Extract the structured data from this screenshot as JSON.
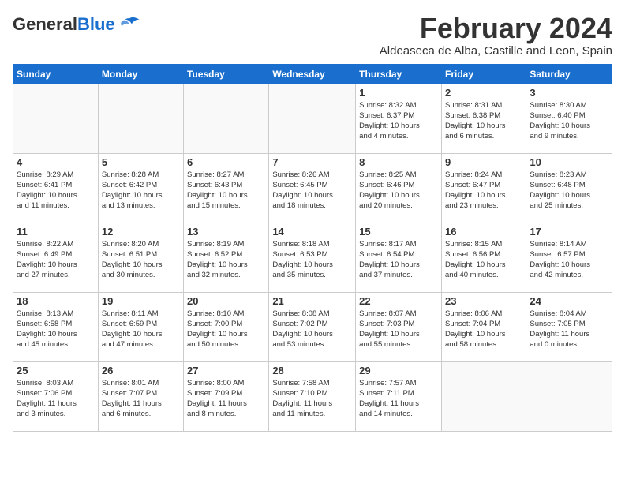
{
  "header": {
    "logo_general": "General",
    "logo_blue": "Blue",
    "month_title": "February 2024",
    "location": "Aldeaseca de Alba, Castille and Leon, Spain"
  },
  "weekdays": [
    "Sunday",
    "Monday",
    "Tuesday",
    "Wednesday",
    "Thursday",
    "Friday",
    "Saturday"
  ],
  "weeks": [
    [
      {
        "day": "",
        "info": ""
      },
      {
        "day": "",
        "info": ""
      },
      {
        "day": "",
        "info": ""
      },
      {
        "day": "",
        "info": ""
      },
      {
        "day": "1",
        "info": "Sunrise: 8:32 AM\nSunset: 6:37 PM\nDaylight: 10 hours\nand 4 minutes."
      },
      {
        "day": "2",
        "info": "Sunrise: 8:31 AM\nSunset: 6:38 PM\nDaylight: 10 hours\nand 6 minutes."
      },
      {
        "day": "3",
        "info": "Sunrise: 8:30 AM\nSunset: 6:40 PM\nDaylight: 10 hours\nand 9 minutes."
      }
    ],
    [
      {
        "day": "4",
        "info": "Sunrise: 8:29 AM\nSunset: 6:41 PM\nDaylight: 10 hours\nand 11 minutes."
      },
      {
        "day": "5",
        "info": "Sunrise: 8:28 AM\nSunset: 6:42 PM\nDaylight: 10 hours\nand 13 minutes."
      },
      {
        "day": "6",
        "info": "Sunrise: 8:27 AM\nSunset: 6:43 PM\nDaylight: 10 hours\nand 15 minutes."
      },
      {
        "day": "7",
        "info": "Sunrise: 8:26 AM\nSunset: 6:45 PM\nDaylight: 10 hours\nand 18 minutes."
      },
      {
        "day": "8",
        "info": "Sunrise: 8:25 AM\nSunset: 6:46 PM\nDaylight: 10 hours\nand 20 minutes."
      },
      {
        "day": "9",
        "info": "Sunrise: 8:24 AM\nSunset: 6:47 PM\nDaylight: 10 hours\nand 23 minutes."
      },
      {
        "day": "10",
        "info": "Sunrise: 8:23 AM\nSunset: 6:48 PM\nDaylight: 10 hours\nand 25 minutes."
      }
    ],
    [
      {
        "day": "11",
        "info": "Sunrise: 8:22 AM\nSunset: 6:49 PM\nDaylight: 10 hours\nand 27 minutes."
      },
      {
        "day": "12",
        "info": "Sunrise: 8:20 AM\nSunset: 6:51 PM\nDaylight: 10 hours\nand 30 minutes."
      },
      {
        "day": "13",
        "info": "Sunrise: 8:19 AM\nSunset: 6:52 PM\nDaylight: 10 hours\nand 32 minutes."
      },
      {
        "day": "14",
        "info": "Sunrise: 8:18 AM\nSunset: 6:53 PM\nDaylight: 10 hours\nand 35 minutes."
      },
      {
        "day": "15",
        "info": "Sunrise: 8:17 AM\nSunset: 6:54 PM\nDaylight: 10 hours\nand 37 minutes."
      },
      {
        "day": "16",
        "info": "Sunrise: 8:15 AM\nSunset: 6:56 PM\nDaylight: 10 hours\nand 40 minutes."
      },
      {
        "day": "17",
        "info": "Sunrise: 8:14 AM\nSunset: 6:57 PM\nDaylight: 10 hours\nand 42 minutes."
      }
    ],
    [
      {
        "day": "18",
        "info": "Sunrise: 8:13 AM\nSunset: 6:58 PM\nDaylight: 10 hours\nand 45 minutes."
      },
      {
        "day": "19",
        "info": "Sunrise: 8:11 AM\nSunset: 6:59 PM\nDaylight: 10 hours\nand 47 minutes."
      },
      {
        "day": "20",
        "info": "Sunrise: 8:10 AM\nSunset: 7:00 PM\nDaylight: 10 hours\nand 50 minutes."
      },
      {
        "day": "21",
        "info": "Sunrise: 8:08 AM\nSunset: 7:02 PM\nDaylight: 10 hours\nand 53 minutes."
      },
      {
        "day": "22",
        "info": "Sunrise: 8:07 AM\nSunset: 7:03 PM\nDaylight: 10 hours\nand 55 minutes."
      },
      {
        "day": "23",
        "info": "Sunrise: 8:06 AM\nSunset: 7:04 PM\nDaylight: 10 hours\nand 58 minutes."
      },
      {
        "day": "24",
        "info": "Sunrise: 8:04 AM\nSunset: 7:05 PM\nDaylight: 11 hours\nand 0 minutes."
      }
    ],
    [
      {
        "day": "25",
        "info": "Sunrise: 8:03 AM\nSunset: 7:06 PM\nDaylight: 11 hours\nand 3 minutes."
      },
      {
        "day": "26",
        "info": "Sunrise: 8:01 AM\nSunset: 7:07 PM\nDaylight: 11 hours\nand 6 minutes."
      },
      {
        "day": "27",
        "info": "Sunrise: 8:00 AM\nSunset: 7:09 PM\nDaylight: 11 hours\nand 8 minutes."
      },
      {
        "day": "28",
        "info": "Sunrise: 7:58 AM\nSunset: 7:10 PM\nDaylight: 11 hours\nand 11 minutes."
      },
      {
        "day": "29",
        "info": "Sunrise: 7:57 AM\nSunset: 7:11 PM\nDaylight: 11 hours\nand 14 minutes."
      },
      {
        "day": "",
        "info": ""
      },
      {
        "day": "",
        "info": ""
      }
    ]
  ]
}
